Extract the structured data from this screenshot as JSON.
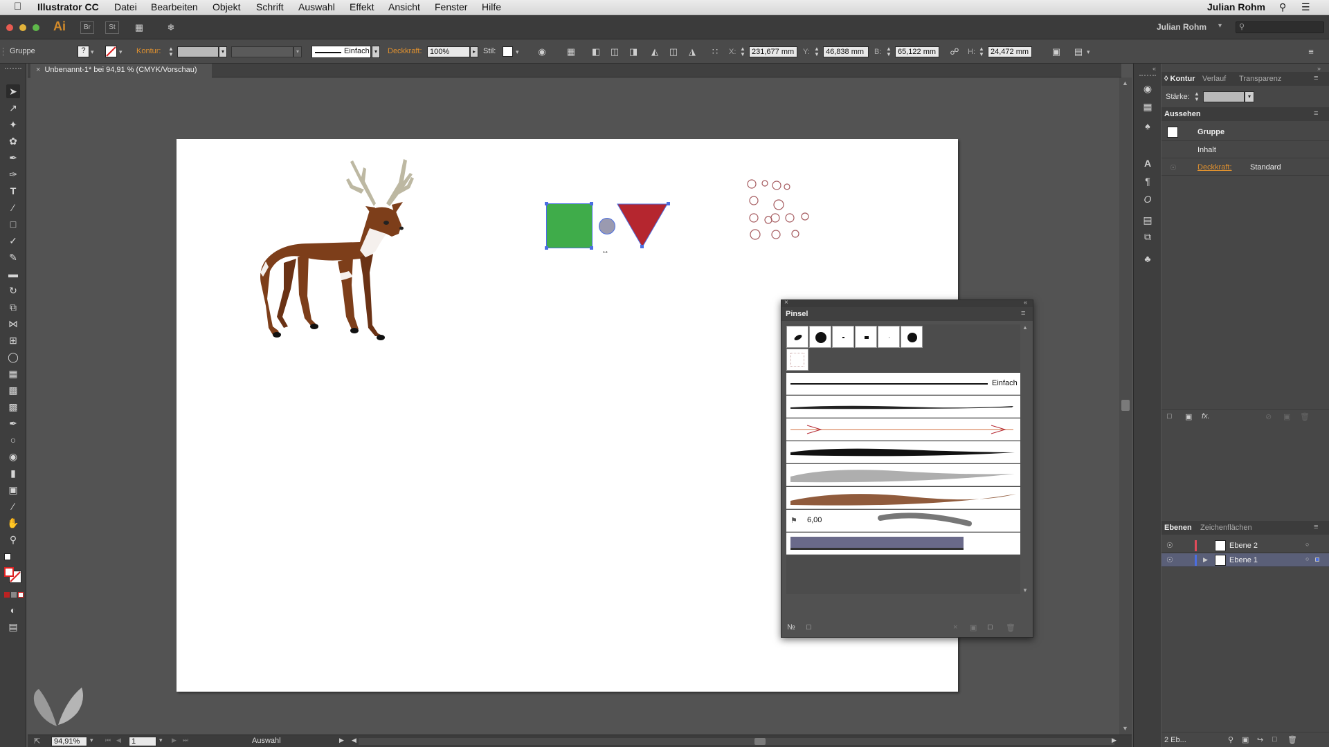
{
  "menubar": {
    "app_name": "Illustrator CC",
    "items": [
      "Datei",
      "Bearbeiten",
      "Objekt",
      "Schrift",
      "Auswahl",
      "Effekt",
      "Ansicht",
      "Fenster",
      "Hilfe"
    ],
    "user": "Julian Rohm"
  },
  "appbar": {
    "logo": "Ai",
    "bridge_label": "Br",
    "stock_label": "St",
    "workspace_user": "Julian Rohm"
  },
  "control": {
    "selection_type": "Gruppe",
    "stroke_label": "Kontur:",
    "stroke_style": "Einfach",
    "opacity_label": "Deckkraft:",
    "opacity_value": "100%",
    "style_label": "Stil:",
    "x_label": "X:",
    "x_value": "231,677 mm",
    "y_label": "Y:",
    "y_value": "46,838 mm",
    "w_label": "B:",
    "w_value": "65,122 mm",
    "h_label": "H:",
    "h_value": "24,472 mm"
  },
  "document": {
    "tab_title": "Unbenannt-1* bei 94,91 % (CMYK/Vorschau)"
  },
  "status": {
    "zoom": "94,91%",
    "page": "1",
    "tool": "Auswahl"
  },
  "right_panel": {
    "tabs": [
      "Kontur",
      "Verlauf",
      "Transparenz"
    ],
    "strength_label": "Stärke:",
    "appearance_title": "Aussehen",
    "appearance_rows": [
      "Gruppe",
      "Inhalt"
    ],
    "opacity_label": "Deckkraft:",
    "opacity_value": "Standard",
    "layers_tabs": [
      "Ebenen",
      "Zeichenflächen"
    ],
    "layers": [
      {
        "name": "Ebene 2",
        "color": "#e24b5a"
      },
      {
        "name": "Ebene 1",
        "color": "#4b6ee2"
      }
    ],
    "layers_count": "2 Eb..."
  },
  "brush_panel": {
    "title": "Pinsel",
    "basic_brush_label": "Einfach",
    "bristle_size": "6,00"
  },
  "colors": {
    "green_square": "#3fac4a",
    "red_triangle": "#b5262f",
    "deer_brown": "#7d3e1a",
    "accent_orange": "#e0912f"
  }
}
